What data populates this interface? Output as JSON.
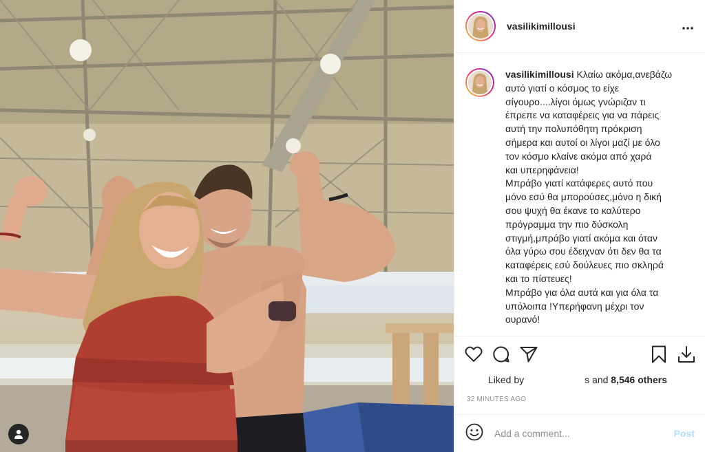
{
  "post": {
    "username": "vasilikimillousi",
    "caption_user": "vasilikimillousi",
    "caption_body": "Κλαίω ακόμα,ανεβάζω\nαυτό γιατί ο κόσμος το είχε\nσίγουρο....λίγοι όμως γνώριζαν τι\nέπρεπε να καταφέρεις για να πάρεις\nαυτή την πολυπόθητη πρόκριση\nσήμερα και αυτοί οι λίγοι μαζί με όλο\nτον κόσμο κλαίνε ακόμα από χαρά\nκαι υπερηφάνεια!\nΜπράβο γιατί κατάφερες αυτό που\nμόνο εσύ θα μπορούσες,μόνο η δική\nσου ψυχή θα έκανε το καλύτερο\nπρόγραμμα την πιο δύσκολη\nστιγμή,μπράβο γιατί ακόμα και όταν\nόλα γύρω σου έδειχναν ότι δεν θα τα\nκαταφέρεις εσύ δούλευες πιο σκληρά\nκαι το πίστευες!\nΜπράβο για όλα αυτά και για όλα τα\nυπόλοιπα !Υπερήφανη μέχρι τον\nουρανό!",
    "liked_by_label": "Liked by",
    "liked_rest_prefix": "s",
    "liked_rest_and": " and ",
    "liked_count": "8,546 others",
    "timestamp": "32 MINUTES AGO"
  },
  "comment": {
    "placeholder": "Add a comment...",
    "post_label": "Post"
  },
  "icons": {
    "more": "more-options-icon",
    "like": "heart-icon",
    "comment": "comment-bubble-icon",
    "share": "paper-plane-icon",
    "save": "bookmark-icon",
    "download": "download-icon",
    "emoji": "smiley-icon",
    "user_tag": "user-tag-icon"
  },
  "colors": {
    "accent_post": "#b2dffc",
    "text": "#262626",
    "muted": "#8e8e8e",
    "divider": "#efefef"
  }
}
